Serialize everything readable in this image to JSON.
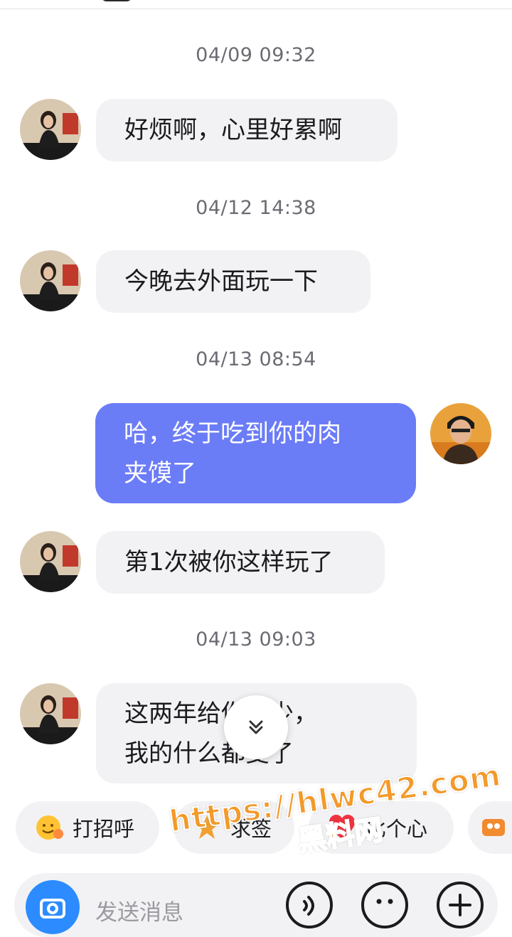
{
  "messages": [
    {
      "time": "04/09 09:32",
      "from": "other",
      "lines": [
        "好烦啊，心里好累啊"
      ]
    },
    {
      "time": "04/12 14:38",
      "from": "other",
      "lines": [
        "今晚去外面玩一下"
      ]
    },
    {
      "time": "04/13 08:54",
      "from": "me",
      "lines": [
        "哈，终于吃到你的肉",
        "夹馍了"
      ]
    },
    {
      "time": "",
      "from": "other",
      "lines": [
        "第1次被你这样玩了"
      ]
    },
    {
      "time": "04/13 09:03",
      "from": "other",
      "lines": [
        "这两年给你多少，",
        "我的什么都变了"
      ]
    }
  ],
  "quick_actions": [
    {
      "label": "打招呼",
      "icon": "wave-emoji-icon"
    },
    {
      "label": "求签",
      "icon": "fortune-icon"
    },
    {
      "label": "比个心",
      "icon": "heart-icon"
    }
  ],
  "input": {
    "placeholder": "发送消息"
  },
  "watermark": {
    "url": "https://hlwc42.com",
    "name": "黑料网"
  },
  "colors": {
    "my_bubble": "#6b7cf7",
    "other_bubble": "#f2f2f4",
    "camera": "#2c8cff"
  }
}
